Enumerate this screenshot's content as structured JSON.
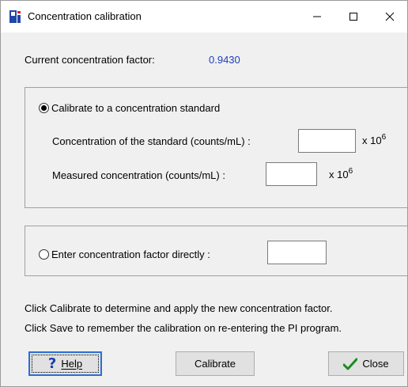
{
  "window": {
    "title": "Concentration calibration",
    "minimize_glyph": "—",
    "close_glyph": "✕"
  },
  "current_factor": {
    "label": "Current concentration factor:",
    "value": "0.9430",
    "value_color": "#1f3fbf"
  },
  "option_standard": {
    "label": "Calibrate to a concentration standard",
    "selected": true,
    "standard_label": "Concentration of the standard (counts/mL) :",
    "standard_value": "",
    "measured_label": "Measured concentration (counts/mL) :",
    "measured_value": "",
    "unit_base": "x 10",
    "unit_exp": "6"
  },
  "option_direct": {
    "label": "Enter concentration factor directly :",
    "selected": false,
    "value": ""
  },
  "instructions": {
    "line1": "Click Calibrate to determine and apply the new concentration factor.",
    "line2": "Click Save to remember the calibration on re-entering the PI program."
  },
  "buttons": {
    "help": "Help",
    "calibrate": "Calibrate",
    "close": "Close"
  },
  "icons": {
    "app": "pi-app-icon",
    "help": "question-mark-icon",
    "close_button": "green-checkmark-icon"
  },
  "colors": {
    "app_icon": "#2046a8",
    "help_icon": "#1a3fb0",
    "checkmark": "#1e8a1e"
  }
}
